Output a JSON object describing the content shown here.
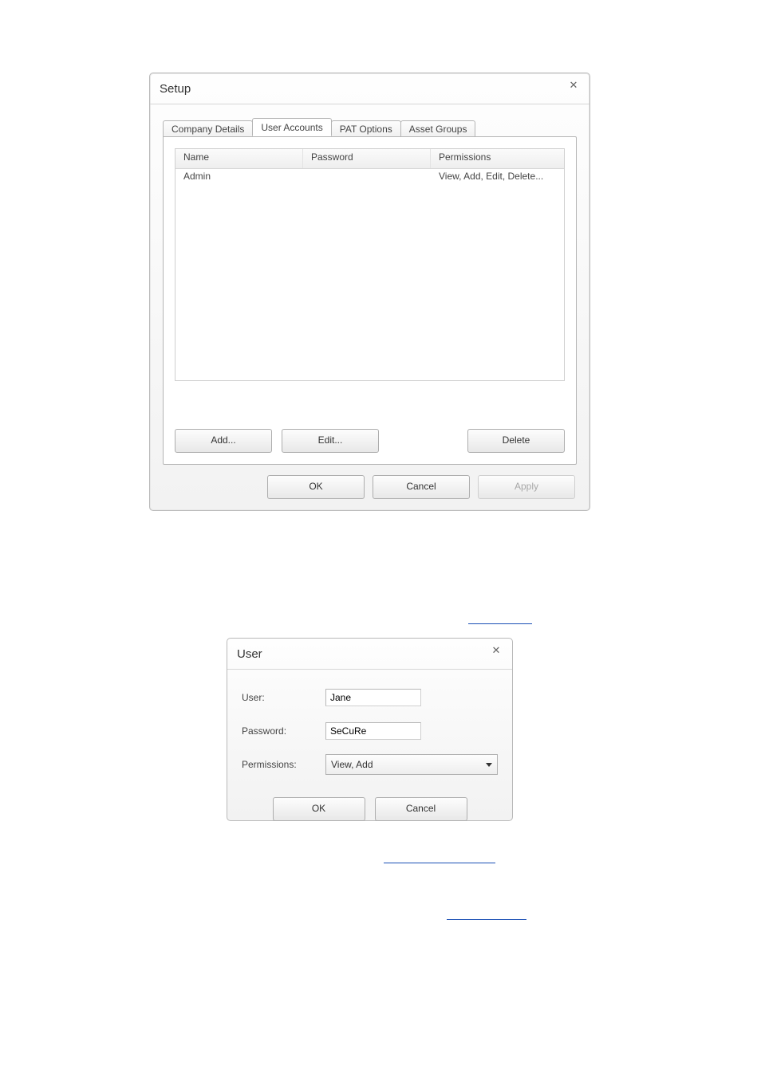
{
  "setup": {
    "title": "Setup",
    "close_glyph": "✕",
    "tabs": [
      {
        "label": "Company Details"
      },
      {
        "label": "User Accounts"
      },
      {
        "label": "PAT Options"
      },
      {
        "label": "Asset Groups"
      }
    ],
    "columns": {
      "name": "Name",
      "password": "Password",
      "permissions": "Permissions"
    },
    "rows": [
      {
        "name": "Admin",
        "password": "",
        "permissions": "View, Add, Edit, Delete..."
      }
    ],
    "buttons": {
      "add": "Add...",
      "edit": "Edit...",
      "delete": "Delete"
    },
    "footer": {
      "ok": "OK",
      "cancel": "Cancel",
      "apply": "Apply"
    }
  },
  "user_dialog": {
    "title": "User",
    "close_glyph": "✕",
    "fields": {
      "user_label": "User:",
      "user_value": "Jane",
      "password_label": "Password:",
      "password_value": "SeCuRe",
      "permissions_label": "Permissions:",
      "permissions_value": "View, Add"
    },
    "footer": {
      "ok": "OK",
      "cancel": "Cancel"
    }
  }
}
